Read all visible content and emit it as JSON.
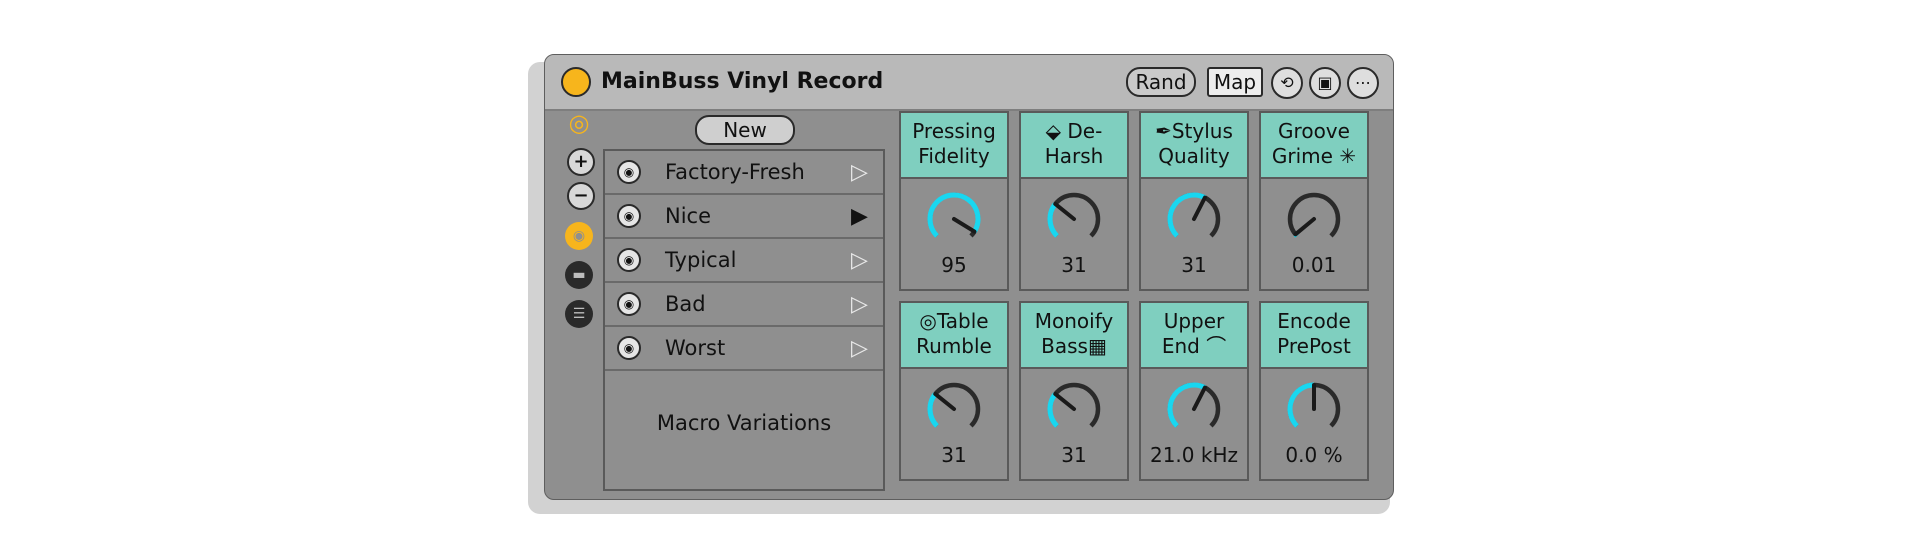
{
  "device": {
    "title": "MainBuss Vinyl Record",
    "buttons": {
      "rand": "Rand",
      "map": "Map"
    }
  },
  "colors": {
    "accent": "#f7b51c",
    "knob_arc": "#19d7f0",
    "macro_header": "#7fcfbf",
    "body": "#8f8f8f"
  },
  "rail_icons": [
    "hotswap-icon",
    "plus-icon",
    "minus-icon",
    "camera-icon",
    "collapse-icon",
    "list-icon"
  ],
  "variations": {
    "new_label": "New",
    "items": [
      {
        "label": "Factory-Fresh",
        "active": false
      },
      {
        "label": "Nice",
        "active": true
      },
      {
        "label": "Typical",
        "active": false
      },
      {
        "label": "Bad",
        "active": false
      },
      {
        "label": "Worst",
        "active": false
      }
    ],
    "title": "Macro Variations"
  },
  "macros": [
    {
      "line1": "Pressing",
      "line2": "Fidelity",
      "value": "95",
      "level": 0.95,
      "icon": ""
    },
    {
      "line1": "De-",
      "line2": "Harsh",
      "value": "31",
      "level": 0.31,
      "icon": "eraser-icon"
    },
    {
      "line1": "Stylus",
      "line2": "Quality",
      "value": "31",
      "level": 0.6,
      "icon": "feather-icon"
    },
    {
      "line1": "Groove",
      "line2": "Grime",
      "value": "0.01",
      "level": 0.02,
      "icon": "bug-icon"
    },
    {
      "line1": "Table",
      "line2": "Rumble",
      "value": "31",
      "level": 0.31,
      "icon": "record-icon"
    },
    {
      "line1": "Monoify",
      "line2": "Bass",
      "value": "31",
      "level": 0.31,
      "icon": "grid-icon"
    },
    {
      "line1": "Upper",
      "line2": "End",
      "value": "21.0 kHz",
      "level": 0.6,
      "icon": "lowpass-icon"
    },
    {
      "line1": "Encode",
      "line2": "PrePost",
      "value": "0.0 %",
      "level": 0.5,
      "icon": ""
    }
  ]
}
